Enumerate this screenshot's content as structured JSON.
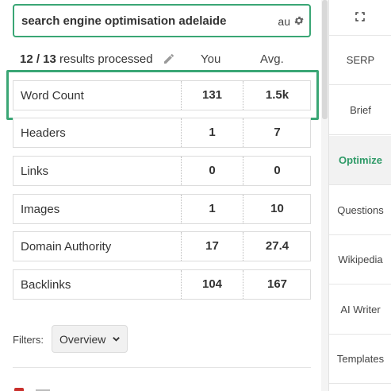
{
  "search": {
    "query": "search engine optimisation adelaide",
    "locale": "au"
  },
  "summary": {
    "processed": "12 / 13",
    "processed_suffix": "results processed",
    "col_you": "You",
    "col_avg": "Avg."
  },
  "metrics": [
    {
      "label": "Word Count",
      "you": "131",
      "avg": "1.5k"
    },
    {
      "label": "Headers",
      "you": "1",
      "avg": "7"
    },
    {
      "label": "Links",
      "you": "0",
      "avg": "0"
    },
    {
      "label": "Images",
      "you": "1",
      "avg": "10"
    },
    {
      "label": "Domain Authority",
      "you": "17",
      "avg": "27.4"
    },
    {
      "label": "Backlinks",
      "you": "104",
      "avg": "167"
    }
  ],
  "filters": {
    "label": "Filters:",
    "selected": "Overview"
  },
  "sidebar": {
    "items": [
      {
        "label": "SERP"
      },
      {
        "label": "Brief"
      },
      {
        "label": "Optimize"
      },
      {
        "label": "Questions"
      },
      {
        "label": "Wikipedia"
      },
      {
        "label": "AI Writer"
      },
      {
        "label": "Templates"
      }
    ],
    "active": "Optimize"
  },
  "colors": {
    "accent": "#3aa675",
    "active_text": "#2e9a67",
    "warning": "#c9302c"
  },
  "icons": [
    "gear-icon",
    "pencil-icon",
    "chevron-down-icon",
    "expand-icon"
  ]
}
